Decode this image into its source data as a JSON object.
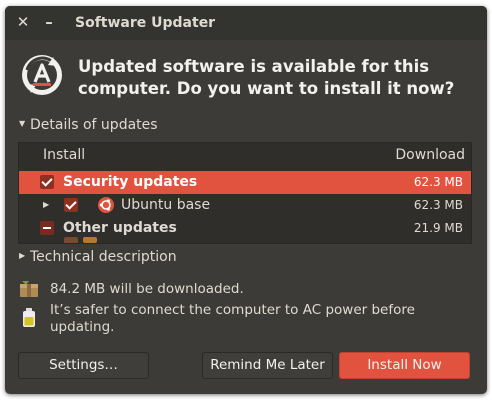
{
  "window": {
    "title": "Software Updater",
    "close_glyph": "✕",
    "minimize_glyph": "–"
  },
  "headline": "Updated software is available for this computer. Do you want to install it now?",
  "details_expander": {
    "label": "Details of updates",
    "expanded": true
  },
  "updates_table": {
    "columns": [
      "Install",
      "Download"
    ],
    "rows": [
      {
        "label": "Security updates",
        "size": "62.3 MB",
        "selected": true,
        "checked": true,
        "bold": true
      },
      {
        "label": "Ubuntu base",
        "size": "62.3 MB",
        "selected": false,
        "checked": true,
        "bold": false,
        "icon": "ubuntu-logo-icon"
      },
      {
        "label": "Other updates",
        "size": "21.9 MB",
        "selected": false,
        "checked": "partial",
        "bold": true
      }
    ]
  },
  "technical_expander": {
    "label": "Technical description",
    "expanded": false
  },
  "info": {
    "download_text": "84.2 MB will be downloaded.",
    "power_text": "It’s safer to connect the computer to AC power before updating."
  },
  "buttons": {
    "settings": "Settings…",
    "remind_later": "Remind Me Later",
    "install_now": "Install Now"
  },
  "colors": {
    "accent": "#e1533e",
    "window_bg": "#3c3b37",
    "list_bg": "#2f2e2b"
  }
}
